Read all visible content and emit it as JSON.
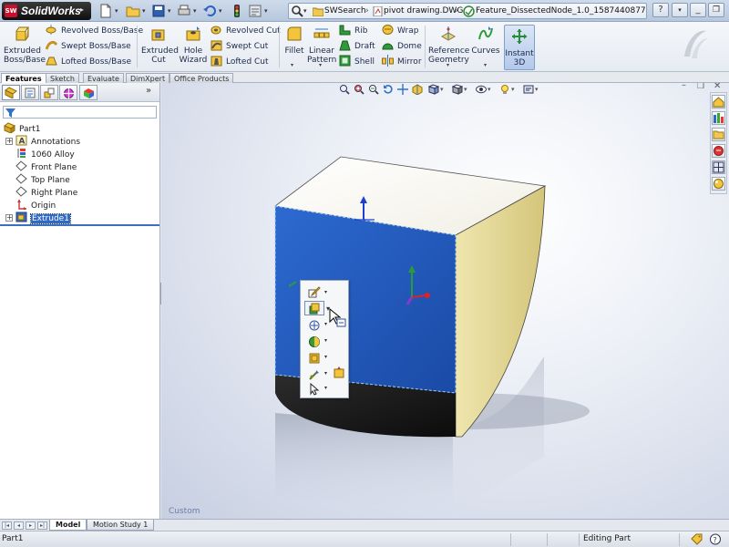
{
  "app": {
    "logo_text": "SolidWorks",
    "logo_badge": "SW"
  },
  "breadcrumb": {
    "items": [
      "SWSearch",
      "pivot drawing.DWG",
      "Feature_DissectedNode_1.0_1587440877"
    ]
  },
  "ribbon": {
    "extruded_boss": "Extruded\nBoss/Base",
    "revolved_boss": "Revolved Boss/Base",
    "swept_boss": "Swept Boss/Base",
    "lofted_boss": "Lofted Boss/Base",
    "extruded_cut": "Extruded\nCut",
    "hole_wizard": "Hole\nWizard",
    "revolved_cut": "Revolved Cut",
    "swept_cut": "Swept Cut",
    "lofted_cut": "Lofted Cut",
    "fillet": "Fillet",
    "linear_pattern": "Linear\nPattern",
    "rib": "Rib",
    "draft": "Draft",
    "shell": "Shell",
    "wrap": "Wrap",
    "dome": "Dome",
    "mirror": "Mirror",
    "reference_geometry": "Reference\nGeometry",
    "curves": "Curves",
    "instant3d": "Instant\n3D"
  },
  "cm_tabs": [
    "Features",
    "Sketch",
    "Evaluate",
    "DimXpert",
    "Office Products"
  ],
  "tree": {
    "root": "Part1",
    "items": [
      {
        "label": "Annotations",
        "icon": "annotations-icon"
      },
      {
        "label": "1060 Alloy",
        "icon": "material-icon"
      },
      {
        "label": "Front Plane",
        "icon": "plane-icon"
      },
      {
        "label": "Top Plane",
        "icon": "plane-icon"
      },
      {
        "label": "Right Plane",
        "icon": "plane-icon"
      },
      {
        "label": "Origin",
        "icon": "origin-icon"
      },
      {
        "label": "Extrude1",
        "icon": "extrude-icon"
      }
    ]
  },
  "viewport": {
    "orientation_label": "Custom"
  },
  "bottom_tabs": [
    "Model",
    "Motion Study 1"
  ],
  "status": {
    "doc_name": "Part1",
    "mode": "Editing Part"
  },
  "colors": {
    "face_blue": "#1f56b8",
    "face_tan": "#e2d696",
    "face_top": "#fbfaf2",
    "face_black": "#1e1e1e",
    "selection": "#316ac5"
  }
}
